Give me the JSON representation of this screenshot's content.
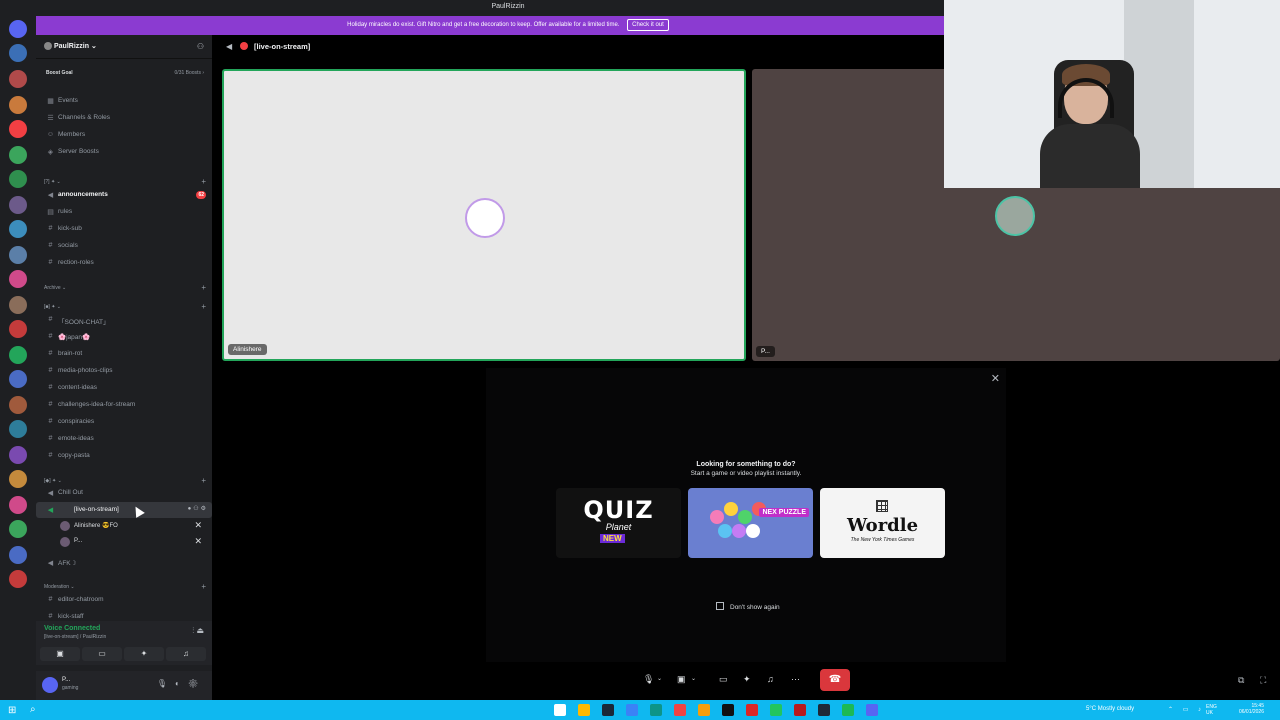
{
  "app": {
    "title": "PaulRizzin"
  },
  "nitro": {
    "text": "Holiday miracles do exist. Gift Nitro and get a free decoration to keep. Offer available for a limited time.",
    "cta": "Check it out"
  },
  "guild": {
    "name": "PaulRizzin ⌄",
    "boost_goal": "Boost Goal",
    "boost_count": "0/31 Boosts ›"
  },
  "menu": [
    {
      "icon": "calendar-icon",
      "glyph": "▦",
      "label": "Events"
    },
    {
      "icon": "channels-roles-icon",
      "glyph": "☰",
      "label": "Channels & Roles"
    },
    {
      "icon": "members-icon",
      "glyph": "☺",
      "label": "Members"
    },
    {
      "icon": "boost-icon",
      "glyph": "◈",
      "label": "Server Boosts"
    }
  ],
  "categories": {
    "c1": "[?] ✦ ⌄",
    "archive": "Archive ⌄",
    "c3": "[■] ✦ ⌄",
    "c4": "[◆] ✦ ⌄",
    "moderation": "Moderation ⌄"
  },
  "channels": {
    "announcements": "announcements",
    "announcements_badge": "62",
    "rules": "rules",
    "kick_sub": "kick-sub",
    "socials": "socials",
    "rection_roles": "rection-roles",
    "soon_chat": "「SOON-CHAT」",
    "japan": "🌸japan🌸",
    "brain_rot": "brain-rot",
    "media": "media-photos-clips",
    "content_ideas": "content-ideas",
    "challenges": "challenges-idea-for-stream",
    "conspiracies": "conspiracies",
    "emote_ideas": "emote-ideas",
    "copy_pasta": "copy-pasta",
    "chill_out": "Chill Out",
    "live_on_stream": "[live-on-stream]",
    "afk": "AFK☽",
    "editor_chatroom": "editor-chatroom",
    "kick_staff": "kick-staff"
  },
  "voice_users": [
    {
      "name": "Alinishere 😎FO"
    },
    {
      "name": "P..."
    }
  ],
  "voice": {
    "status": "Voice Connected",
    "sub": "[live-on-stream] / PaulRizzin"
  },
  "user": {
    "name": "P...",
    "status": "gaming"
  },
  "call": {
    "channel": "[live-on-stream]",
    "tile1_label": "Alinishere",
    "tile2_label": "P..."
  },
  "activity": {
    "heading": "Looking for something to do?",
    "subheading": "Start a game or video playlist instantly.",
    "game1_title": "QUIZ",
    "game1_sub": "Planet",
    "game1_badge": "NEW",
    "game2_badge": "NEX PUZZLE",
    "game3_title": "Wordle",
    "game3_sub": "The New York Times Games",
    "dont_show": "Don't show again"
  },
  "taskbar": {
    "weather": "5°C  Mostly cloudy",
    "lang": "ENG UK",
    "time": "15:45",
    "date": "06/01/2026"
  }
}
